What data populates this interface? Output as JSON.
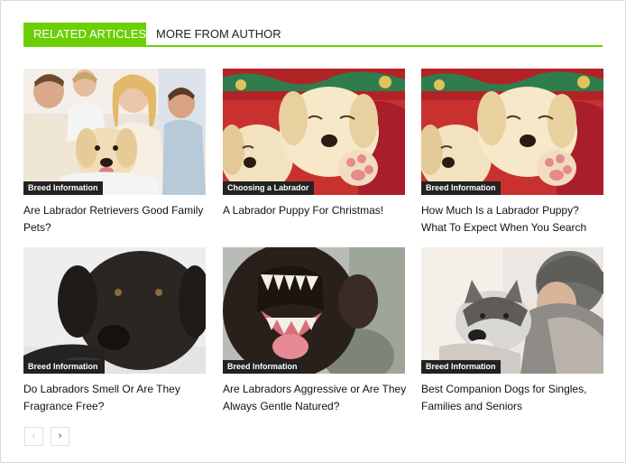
{
  "tabs": {
    "active": "RELATED ARTICLES",
    "other": "MORE FROM AUTHOR"
  },
  "articles": [
    {
      "category": "Breed Information",
      "title": "Are Labrador Retrievers Good Family Pets?",
      "image": "family-with-labrador-photo"
    },
    {
      "category": "Choosing a Labrador",
      "title": "A Labrador Puppy For Christmas!",
      "image": "labrador-puppies-christmas-photo"
    },
    {
      "category": "Breed Information",
      "title": "How Much Is a Labrador Puppy? What To Expect When You Search",
      "image": "labrador-puppies-christmas-photo"
    },
    {
      "category": "Breed Information",
      "title": "Do Labradors Smell Or Are They Fragrance Free?",
      "image": "black-labrador-photo"
    },
    {
      "category": "Breed Information",
      "title": "Are Labradors Aggressive or Are They Always Gentle Natured?",
      "image": "growling-dog-photo"
    },
    {
      "category": "Breed Information",
      "title": "Best Companion Dogs for Singles, Families and Seniors",
      "image": "woman-hugging-husky-photo"
    }
  ],
  "pagination": {
    "prev_icon": "chevron-left-icon",
    "next_icon": "chevron-right-icon",
    "prev_glyph": "‹",
    "next_glyph": "›"
  },
  "colors": {
    "accent": "#6ccf04",
    "badge_bg": "#222222"
  }
}
